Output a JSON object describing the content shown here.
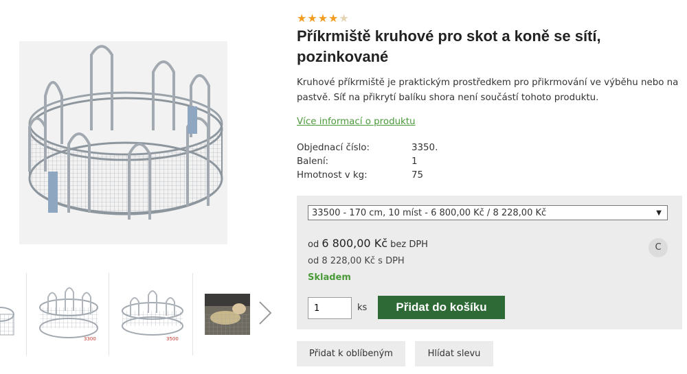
{
  "product": {
    "rating": {
      "value": 4,
      "max": 5,
      "star_on": "★★★★",
      "star_off": "★"
    },
    "title": "Příkrmiště kruhové pro skot a koně se sítí, pozinkované",
    "description": "Kruhové příkrmiště je praktickým prostředkem pro přikrmování ve výběhu nebo na pastvě. Síť na přikrytí balíku shora není součástí tohoto produktu.",
    "more_info_link": "Více informací o produktu",
    "specs": [
      {
        "label": "Objednací číslo:",
        "value": "3350."
      },
      {
        "label": "Balení:",
        "value": "1"
      },
      {
        "label": "Hmotnost v kg:",
        "value": "75"
      }
    ]
  },
  "gallery": {
    "thumbs": [
      {
        "label": ""
      },
      {
        "label": "3300"
      },
      {
        "label": "3500"
      },
      {
        "label": ""
      }
    ],
    "next_icon": "chevron-right-icon"
  },
  "buybox": {
    "variant_selected": "33500 - 170 cm, 10 míst - 6 800,00 Kč / 8 228,00 Kč",
    "price_prefix": "od",
    "price_excl": "6 800,00 Kč",
    "price_excl_suffix": "bez DPH",
    "price_incl": "od 8 228,00 Kč s DPH",
    "stock": "Skladem",
    "compare_label": "C",
    "qty_value": "1",
    "unit": "ks",
    "add_to_cart": "Přidat do košíku"
  },
  "actions": {
    "favorite": "Přidat k oblíbeným",
    "watch_price": "Hlídat slevu"
  },
  "colors": {
    "accent_green": "#2d6a35",
    "link_green": "#4a9a3a",
    "star": "#f39c1f",
    "panel": "#ececec"
  }
}
